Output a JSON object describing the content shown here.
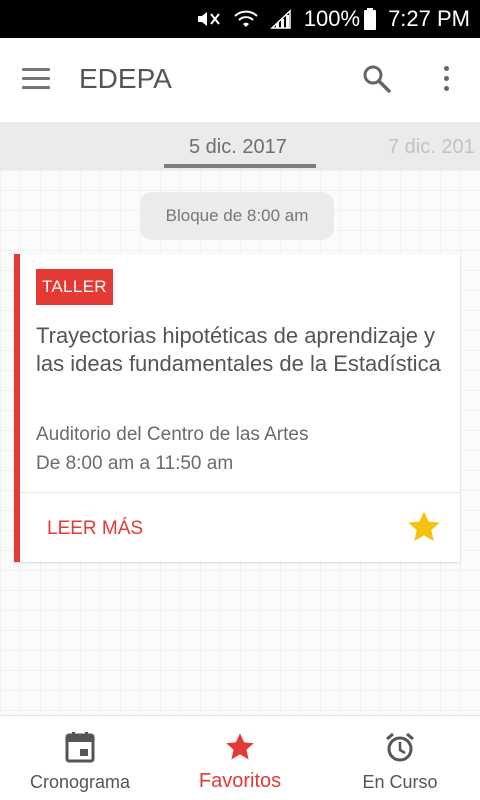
{
  "status_bar": {
    "battery": "100%",
    "time": "7:27 PM",
    "icons": [
      "mute-icon",
      "wifi-icon",
      "signal-icon",
      "battery-icon"
    ]
  },
  "app_bar": {
    "title": "EDEPA",
    "icons": [
      "menu-icon",
      "search-icon",
      "more-vert-icon"
    ]
  },
  "date_tabs": {
    "active": "5 dic. 2017",
    "next": "7 dic. 201"
  },
  "schedule": {
    "block_label": "Bloque de 8:00 am",
    "event": {
      "badge": "TALLER",
      "title": "Trayectorias hipotéticas de aprendizaje y las ideas fundamentales de la Estadística",
      "location": "Auditorio del Centro de las Artes",
      "time": "De 8:00 am a 11:50 am",
      "read_more": "LEER MÁS",
      "favorite": true
    }
  },
  "bottom_nav": {
    "items": [
      {
        "label": "Cronograma",
        "icon": "calendar-icon",
        "active": false
      },
      {
        "label": "Favoritos",
        "icon": "star-icon",
        "active": true
      },
      {
        "label": "En Curso",
        "icon": "alarm-clock-icon",
        "active": false
      }
    ]
  },
  "colors": {
    "accent": "#e53935",
    "star": "#f4c20d",
    "text": "#555555"
  }
}
